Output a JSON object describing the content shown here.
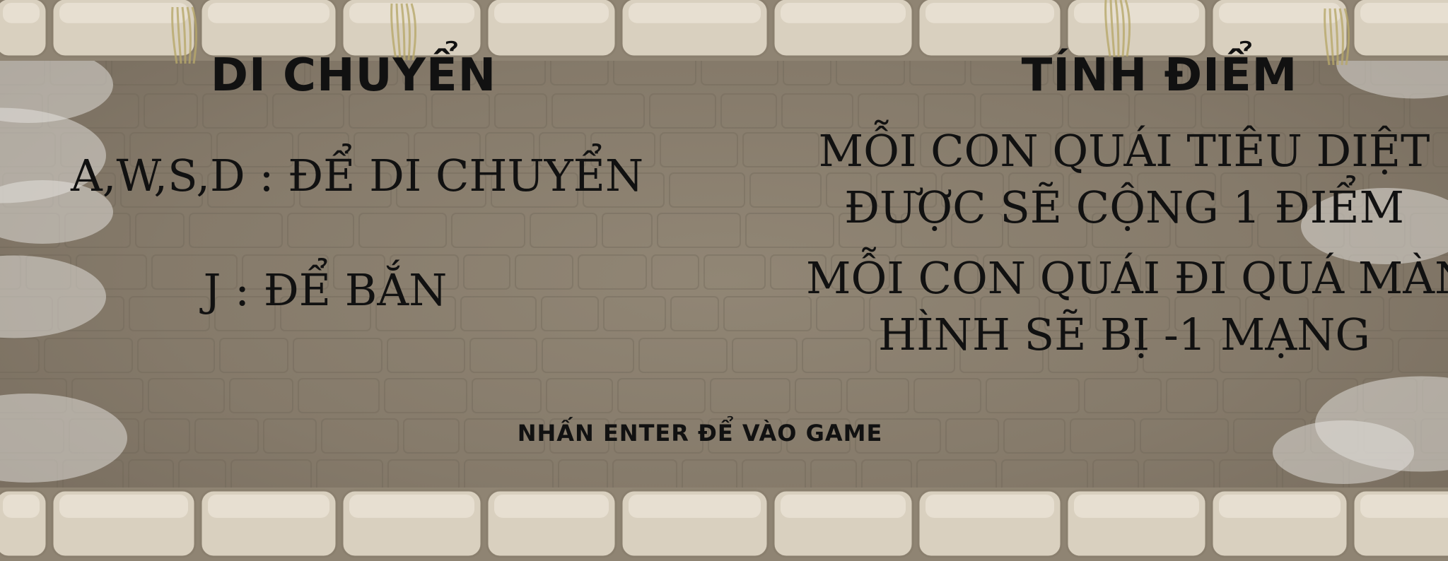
{
  "controls": {
    "title": "DI CHUYỂN",
    "lines": [
      "A,W,S,D : ĐỂ DI CHUYỂN",
      "J : ĐỂ BẮN"
    ]
  },
  "scoring": {
    "title": "TÍNH ĐIỂM",
    "rule1": [
      "MỖI CON QUÁI TIÊU DIỆT",
      "ĐƯỢC SẼ CỘNG 1 ĐIỂM"
    ],
    "rule2": [
      "MỖI CON QUÁI ĐI QUÁ MÀN",
      "HÌNH SẼ BỊ -1 MẠNG"
    ]
  },
  "prompt": "NHẤN ENTER ĐỂ VÀO GAME",
  "colors": {
    "text": "#111111",
    "floor": "#857a6a",
    "wall_stone": "#d9d0bf",
    "wall_shadow": "#8f8473",
    "cloud": "#e8e6e2"
  }
}
